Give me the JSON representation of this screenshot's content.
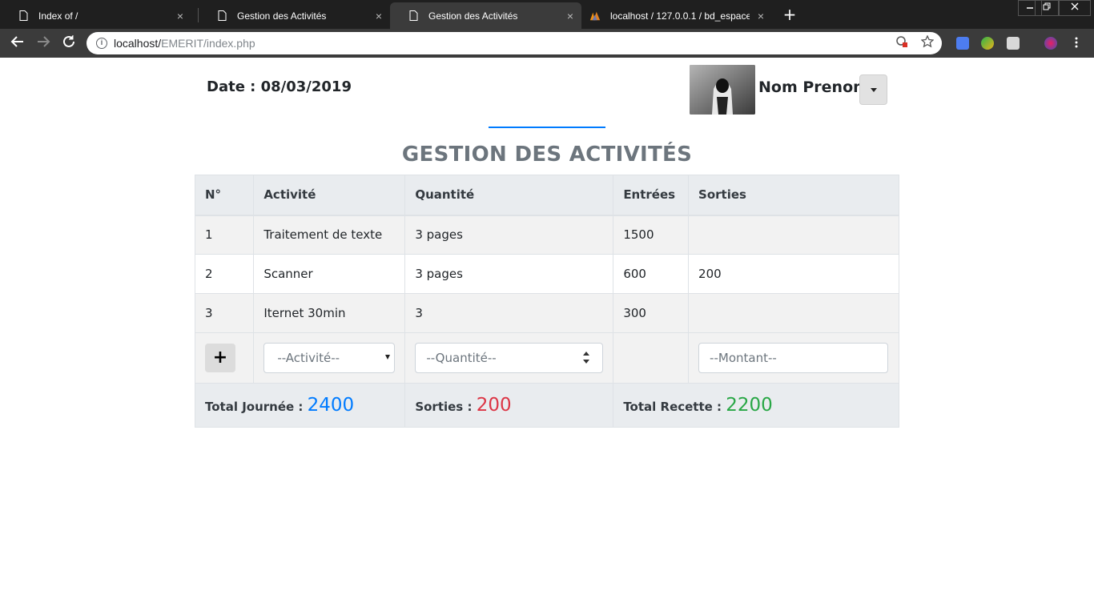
{
  "browser": {
    "tabs": [
      {
        "title": "Index of /",
        "icon": "page-icon",
        "active": false
      },
      {
        "title": "Gestion des Activités",
        "icon": "page-icon",
        "active": false
      },
      {
        "title": "Gestion des Activités",
        "icon": "page-icon",
        "active": true
      },
      {
        "title": "localhost / 127.0.0.1 / bd_espace",
        "icon": "phpmyadmin-icon",
        "active": false
      }
    ],
    "url_host": "localhost/",
    "url_path": "EMERIT/index.php",
    "close_glyph": "×",
    "new_tab_glyph": "+"
  },
  "header": {
    "date_label": "Date : 08/03/2019",
    "user_name": "Nom Prenom"
  },
  "page": {
    "title": "GESTION DES ACTIVITÉS"
  },
  "table": {
    "headers": [
      "N°",
      "Activité",
      "Quantité",
      "Entrées",
      "Sorties"
    ],
    "rows": [
      [
        "1",
        "Traitement de texte",
        "3 pages",
        "1500",
        ""
      ],
      [
        "2",
        "Scanner",
        "3 pages",
        "600",
        "200"
      ],
      [
        "3",
        "Iternet 30min",
        "3",
        "300",
        ""
      ]
    ],
    "form": {
      "add_label": "+",
      "activity_placeholder": "--Activité--",
      "quantity_placeholder": "--Quantité--",
      "amount_placeholder": "--Montant--"
    },
    "totals": {
      "journee_label": "Total Journée :",
      "journee_value": "2400",
      "sorties_label": "Sorties :",
      "sorties_value": "200",
      "recette_label": "Total Recette :",
      "recette_value": "2200"
    }
  },
  "colors": {
    "accent_blue": "#007bff",
    "danger_red": "#dc3545",
    "success_green": "#28a745",
    "title_gray": "#6c757d"
  }
}
